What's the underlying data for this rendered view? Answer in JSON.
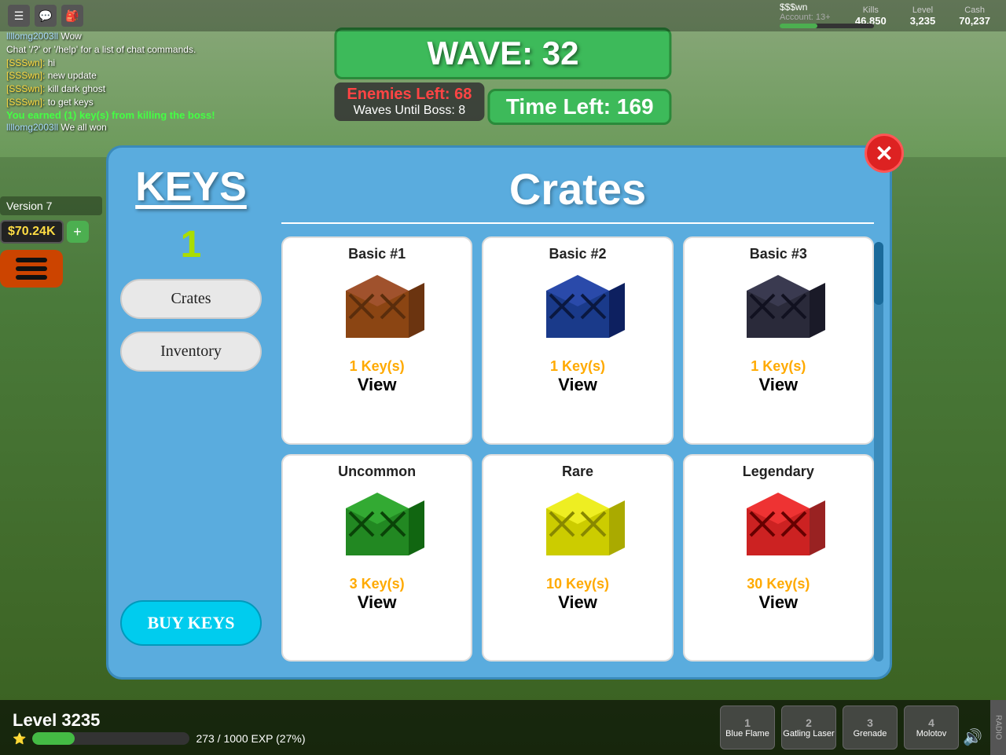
{
  "topHud": {
    "icons": [
      "☰",
      "💬",
      "🎒"
    ],
    "account": {
      "name": "$$$wn",
      "subtitle": "Account: 13+",
      "progressPct": 40
    },
    "stats": [
      {
        "label": "Kills",
        "value": "46,850"
      },
      {
        "label": "Level",
        "value": "3,235"
      },
      {
        "label": "Cash",
        "value": "70,237"
      }
    ]
  },
  "wave": {
    "label": "WAVE: 32",
    "enemiesLeft": "Enemies Left: 68",
    "wavesBoss": "Waves Until Boss: 8",
    "timeLeft": "Time Left: 169"
  },
  "chat": [
    {
      "user": "llllomg2003ll",
      "color": "#aaddff",
      "msg": " Wow"
    },
    {
      "user": "",
      "color": "white",
      "msg": "Chat '/?' or '/help' for a list of chat commands."
    },
    {
      "user": "[SSSwn]:",
      "color": "#ffdd44",
      "msg": " hi"
    },
    {
      "user": "[SSSwn]:",
      "color": "#ffdd44",
      "msg": " new update"
    },
    {
      "user": "[SSSwn]:",
      "color": "#ffdd44",
      "msg": " kill dark ghost"
    },
    {
      "user": "[SSSwn]:",
      "color": "#ffdd44",
      "msg": " to get keys"
    },
    {
      "earned": "You earned (1) key(s) from killing the boss!"
    },
    {
      "user": "llllomg2003ll",
      "color": "#aaddff",
      "msg": " We all won"
    }
  ],
  "sidebar": {
    "version": "Version 7",
    "money": "$70.24K",
    "keys": {
      "title": "KEYS",
      "count": "1"
    },
    "navItems": [
      {
        "label": "Crates",
        "active": false
      },
      {
        "label": "Inventory",
        "active": false
      }
    ],
    "buyKeys": "BUY KEYS"
  },
  "cratesPanel": {
    "title": "Crates",
    "crates": [
      {
        "name": "Basic #1",
        "keys": "1 Key(s)",
        "view": "View",
        "color": "brown",
        "type": "basic1"
      },
      {
        "name": "Basic #2",
        "keys": "1 Key(s)",
        "view": "View",
        "color": "darkblue",
        "type": "basic2"
      },
      {
        "name": "Basic #3",
        "keys": "1 Key(s)",
        "view": "View",
        "color": "darkgray",
        "type": "basic3"
      },
      {
        "name": "Uncommon",
        "keys": "3 Key(s)",
        "view": "View",
        "color": "green",
        "type": "uncommon"
      },
      {
        "name": "Rare",
        "keys": "10 Key(s)",
        "view": "View",
        "color": "yellow",
        "type": "rare"
      },
      {
        "name": "Legendary",
        "keys": "30 Key(s)",
        "view": "View",
        "color": "red",
        "type": "legendary"
      }
    ]
  },
  "bottomHud": {
    "level": "Level 3235",
    "expCurrent": "273",
    "expMax": "1000",
    "expPct": 27,
    "expLabel": "273 / 1000 EXP (27%)",
    "weapons": [
      {
        "slot": "1",
        "name": "Blue Flame"
      },
      {
        "slot": "2",
        "name": "Gatling Laser"
      },
      {
        "slot": "3",
        "name": "Grenade"
      },
      {
        "slot": "4",
        "name": "Molotov"
      }
    ],
    "radioLabel": "RADIO"
  }
}
